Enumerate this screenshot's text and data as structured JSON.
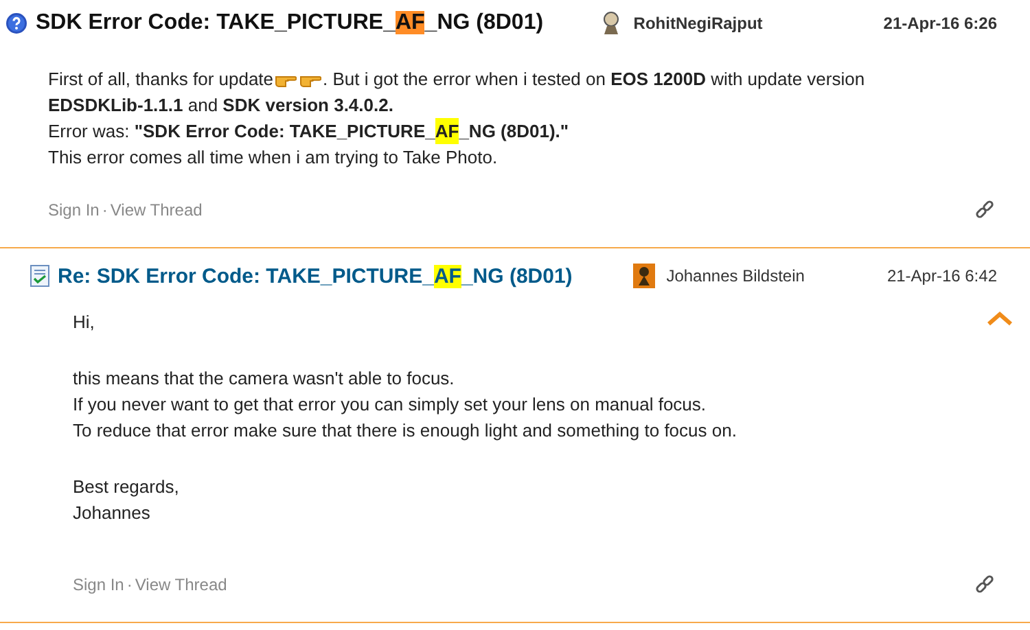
{
  "posts": [
    {
      "kind": "question",
      "title": [
        {
          "text": "SDK Error Code: TAKE_PICTURE_"
        },
        {
          "text": "AF",
          "color": "#ff8c26"
        },
        {
          "text": "_NG (8D01)"
        }
      ],
      "author": "RohitNegiRajput",
      "date": "21-Apr-16 6:26",
      "body": [
        {
          "parts": [
            {
              "kind": "text",
              "text": "First of all, thanks for update"
            },
            {
              "kind": "emoji"
            },
            {
              "kind": "emoji"
            },
            {
              "kind": "text",
              "text": ". But i got the error when i tested on **EOS 1200D** with update version"
            }
          ]
        },
        {
          "parts": [
            {
              "kind": "text",
              "text": "**EDSDKLib-1.1.1** and **SDK version 3.4.0.2.**"
            }
          ]
        },
        {
          "parts": [
            {
              "kind": "text",
              "text": "Error was: **\"SDK Error Code: TAKE_PICTURE_**"
            },
            {
              "kind": "text",
              "text": "**AF**",
              "color": "#ffff00"
            },
            {
              "kind": "text",
              "text": "**_NG (8D01).\"**"
            }
          ]
        },
        {
          "parts": [
            {
              "kind": "text",
              "text": "This error comes all time when i am trying to Take Photo."
            }
          ]
        }
      ],
      "links": [
        "Sign In",
        "View Thread"
      ],
      "link_separator": "·"
    },
    {
      "kind": "answer",
      "title": [
        {
          "text": "Re: SDK Error Code: TAKE_PICTURE_"
        },
        {
          "text": "AF",
          "color": "#ffff00"
        },
        {
          "text": "_NG (8D01)"
        }
      ],
      "author": "Johannes Bildstein",
      "date": "21-Apr-16 6:42",
      "collapse_button": true,
      "body": [
        {
          "parts": [
            {
              "kind": "text",
              "text": "Hi,"
            }
          ]
        },
        {
          "kind": "blank"
        },
        {
          "parts": [
            {
              "kind": "text",
              "text": "this means that the camera wasn't able to focus."
            }
          ]
        },
        {
          "parts": [
            {
              "kind": "text",
              "text": "If you never want to get that error you can simply set your lens on manual focus."
            }
          ]
        },
        {
          "parts": [
            {
              "kind": "text",
              "text": "To reduce that error make sure that there is enough light and something to focus on."
            }
          ]
        },
        {
          "kind": "blank"
        },
        {
          "parts": [
            {
              "kind": "text",
              "text": "Best regards,"
            }
          ]
        },
        {
          "parts": [
            {
              "kind": "text",
              "text": "Johannes"
            }
          ]
        }
      ],
      "links": [
        "Sign In",
        "View Thread"
      ],
      "link_separator": "·"
    }
  ]
}
